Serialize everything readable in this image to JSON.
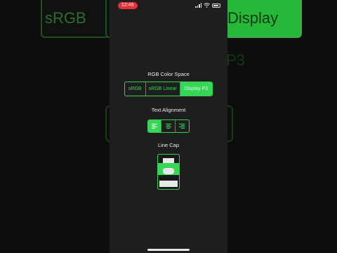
{
  "status_bar": {
    "time": "12:49"
  },
  "background": {
    "left_label": "sRGB",
    "right_label": "Display P3"
  },
  "color_space": {
    "title": "RGB Color Space",
    "options": [
      "sRGB",
      "sRGB Linear",
      "Display P3"
    ],
    "selected": "Display P3"
  },
  "text_alignment": {
    "title": "Text Alignment",
    "options": [
      "align-left-icon",
      "align-center-icon",
      "align-right-icon"
    ],
    "selected": "align-left-icon"
  },
  "line_cap": {
    "title": "Line Cap"
  },
  "colors": {
    "accent": "#38d657",
    "background": "#1e1e1e"
  }
}
